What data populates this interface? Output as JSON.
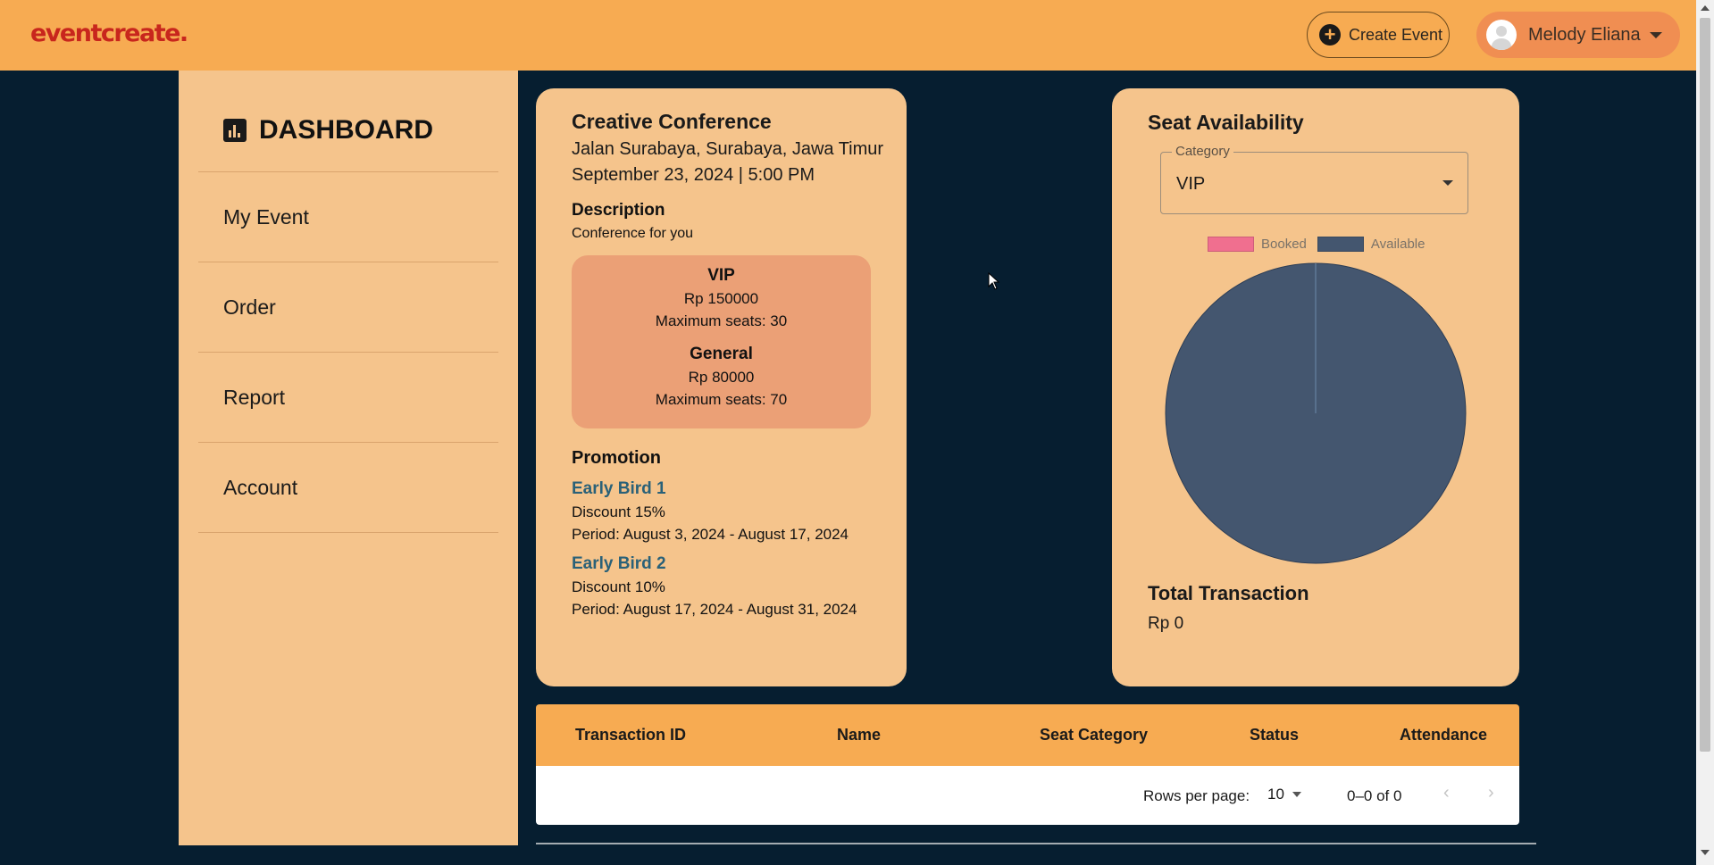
{
  "header": {
    "logo": "eventcreate.",
    "create_event_label": "Create Event",
    "user_name": "Melody Eliana"
  },
  "sidebar": {
    "title": "DASHBOARD",
    "items": [
      {
        "label": "My Event"
      },
      {
        "label": "Order"
      },
      {
        "label": "Report"
      },
      {
        "label": "Account"
      }
    ]
  },
  "event": {
    "title": "Creative Conference",
    "address": "Jalan Surabaya, Surabaya, Jawa Timur",
    "datetime": "September 23, 2024 | 5:00 PM",
    "description_label": "Description",
    "description": "Conference for you",
    "seats": [
      {
        "name": "VIP",
        "price": "Rp 150000",
        "max": "Maximum seats: 30"
      },
      {
        "name": "General",
        "price": "Rp 80000",
        "max": "Maximum seats: 70"
      }
    ],
    "promotion_label": "Promotion",
    "promotions": [
      {
        "name": "Early Bird 1",
        "discount": "Discount 15%",
        "period": "Period: August 3, 2024 - August 17, 2024"
      },
      {
        "name": "Early Bird 2",
        "discount": "Discount 10%",
        "period": "Period: August 17, 2024 - August 31, 2024"
      }
    ]
  },
  "seat_availability": {
    "title": "Seat Availability",
    "category_label": "Category",
    "category_value": "VIP",
    "legend": [
      {
        "label": "Booked",
        "color": "#f06f8f"
      },
      {
        "label": "Available",
        "color": "#44566f"
      }
    ],
    "total_transaction_label": "Total Transaction",
    "total_transaction_value": "Rp 0"
  },
  "chart_data": {
    "type": "pie",
    "categories": [
      "Booked",
      "Available"
    ],
    "values": [
      0,
      30
    ],
    "colors": [
      "#f06f8f",
      "#44566f"
    ],
    "legend": "top"
  },
  "table": {
    "columns": [
      "Transaction ID",
      "Name",
      "Seat Category",
      "Status",
      "Attendance"
    ],
    "rows": [],
    "rows_per_page_label": "Rows per page:",
    "rows_per_page_value": "10",
    "range": "0–0 of 0",
    "prev_icon": "chevron-left-icon",
    "next_icon": "chevron-right-icon"
  }
}
